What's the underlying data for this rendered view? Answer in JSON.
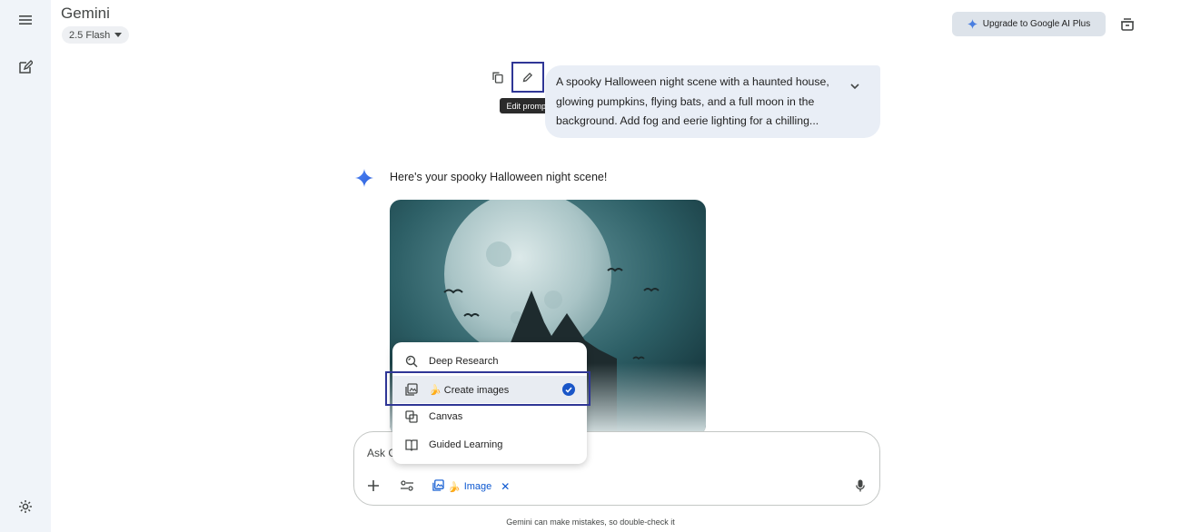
{
  "header": {
    "app_title": "Gemini",
    "model_selector": "2.5 Flash",
    "upgrade_label": "Upgrade to Google AI Plus"
  },
  "sidebar": {
    "icons": [
      "menu-icon",
      "new-chat-icon",
      "settings-icon"
    ]
  },
  "user_message": {
    "text": "A spooky Halloween night scene with a haunted house, glowing pumpkins, flying bats, and a full moon in the background. Add fog and eerie lighting for a chilling...",
    "edit_tooltip": "Edit prompt"
  },
  "response": {
    "text": "Here's your spooky Halloween night scene!"
  },
  "mode_menu": {
    "items": [
      {
        "label": "Deep Research",
        "icon": "deep-research-icon",
        "selected": false
      },
      {
        "label": "Create images",
        "emoji": "🍌",
        "icon": "create-images-icon",
        "selected": true
      },
      {
        "label": "Canvas",
        "icon": "canvas-icon",
        "selected": false
      },
      {
        "label": "Guided Learning",
        "icon": "guided-learning-icon",
        "selected": false
      }
    ]
  },
  "composer": {
    "input_value": "Ask G",
    "image_chip_label": "Image",
    "image_chip_emoji": "🍌",
    "close_glyph": "✕"
  },
  "footer": {
    "disclaimer": "Gemini can make mistakes, so double-check it"
  },
  "colors": {
    "accent": "#0b57d0",
    "highlight_border": "#2f3696",
    "sidebar_bg": "#f0f4f9",
    "bubble_bg": "#e9eef6"
  }
}
